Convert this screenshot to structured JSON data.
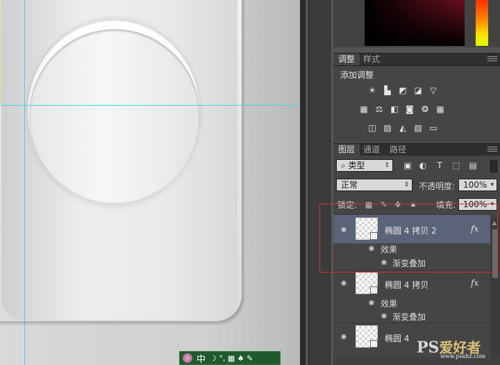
{
  "adjustments": {
    "tabs": [
      "调整",
      "样式"
    ],
    "title": "添加调整",
    "icons_row1": [
      "brightness-contrast-icon",
      "levels-icon",
      "curves-icon",
      "exposure-icon",
      "vibrance-icon"
    ],
    "icons_row2": [
      "hue-saturation-icon",
      "color-balance-icon",
      "black-white-icon",
      "photo-filter-icon",
      "channel-mixer-icon",
      "color-lookup-icon"
    ],
    "icons_row3": [
      "invert-icon",
      "posterize-icon",
      "threshold-icon",
      "selective-color-icon",
      "gradient-map-icon"
    ]
  },
  "layers": {
    "tabs": [
      "图层",
      "通道",
      "路径"
    ],
    "filter_kind": "类型",
    "blend_mode": "正常",
    "opacity_label": "不透明度:",
    "opacity_value": "100%",
    "lock_label": "锁定:",
    "fill_label": "填充:",
    "fill_value": "100%",
    "items": [
      {
        "name": "椭圆 4 拷贝 2",
        "fx": "fx",
        "effects_label": "效果",
        "effect": "渐变叠加",
        "selected": true
      },
      {
        "name": "椭圆 4 拷贝",
        "fx": "fx",
        "effects_label": "效果",
        "effect": "渐变叠加",
        "selected": false
      },
      {
        "name": "椭圆 4",
        "selected": false
      }
    ]
  },
  "ime": {
    "mode": "中",
    "symbols": "☽ °, ▦ ♠ ✎"
  },
  "watermark": {
    "ps": "PS",
    "zh": "爱好者",
    "url": "www.psahz.com"
  },
  "colors": {
    "panel_bg": "#454545",
    "selected_layer": "#5a6377",
    "guide": "#36d9df",
    "highlight_box": "#d92f2f"
  }
}
